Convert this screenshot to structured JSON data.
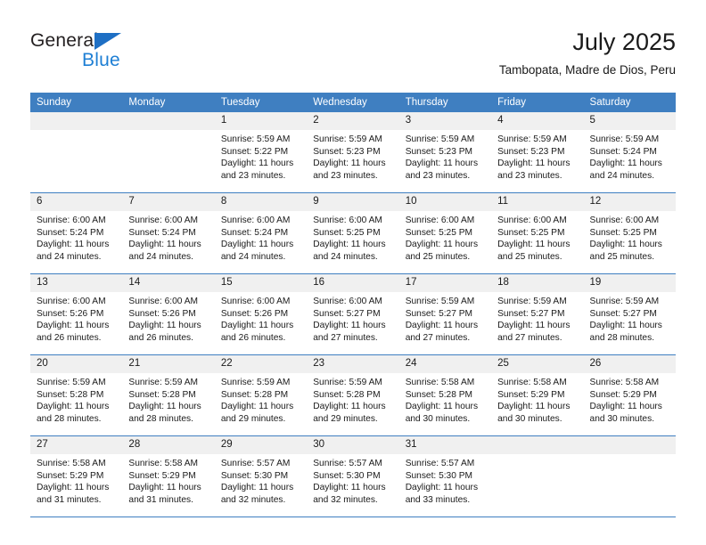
{
  "brand": {
    "general": "General",
    "blue": "Blue",
    "triangle_color": "#1e6fc4",
    "blue_color": "#1e7fd4"
  },
  "header": {
    "title": "July 2025",
    "subtitle": "Tambopata, Madre de Dios, Peru"
  },
  "theme": {
    "header_bg": "#3f7fc1",
    "header_text": "#ffffff",
    "daynum_bg": "#f0f0f0",
    "cell_bg": "#ffffff",
    "row_divider": "#3f7fc1",
    "text": "#1a1a1a"
  },
  "weekdays": [
    "Sunday",
    "Monday",
    "Tuesday",
    "Wednesday",
    "Thursday",
    "Friday",
    "Saturday"
  ],
  "weeks": [
    [
      {
        "day": "",
        "empty": true
      },
      {
        "day": "",
        "empty": true
      },
      {
        "day": "1",
        "sunrise": "Sunrise: 5:59 AM",
        "sunset": "Sunset: 5:22 PM",
        "daylight1": "Daylight: 11 hours",
        "daylight2": "and 23 minutes."
      },
      {
        "day": "2",
        "sunrise": "Sunrise: 5:59 AM",
        "sunset": "Sunset: 5:23 PM",
        "daylight1": "Daylight: 11 hours",
        "daylight2": "and 23 minutes."
      },
      {
        "day": "3",
        "sunrise": "Sunrise: 5:59 AM",
        "sunset": "Sunset: 5:23 PM",
        "daylight1": "Daylight: 11 hours",
        "daylight2": "and 23 minutes."
      },
      {
        "day": "4",
        "sunrise": "Sunrise: 5:59 AM",
        "sunset": "Sunset: 5:23 PM",
        "daylight1": "Daylight: 11 hours",
        "daylight2": "and 23 minutes."
      },
      {
        "day": "5",
        "sunrise": "Sunrise: 5:59 AM",
        "sunset": "Sunset: 5:24 PM",
        "daylight1": "Daylight: 11 hours",
        "daylight2": "and 24 minutes."
      }
    ],
    [
      {
        "day": "6",
        "sunrise": "Sunrise: 6:00 AM",
        "sunset": "Sunset: 5:24 PM",
        "daylight1": "Daylight: 11 hours",
        "daylight2": "and 24 minutes."
      },
      {
        "day": "7",
        "sunrise": "Sunrise: 6:00 AM",
        "sunset": "Sunset: 5:24 PM",
        "daylight1": "Daylight: 11 hours",
        "daylight2": "and 24 minutes."
      },
      {
        "day": "8",
        "sunrise": "Sunrise: 6:00 AM",
        "sunset": "Sunset: 5:24 PM",
        "daylight1": "Daylight: 11 hours",
        "daylight2": "and 24 minutes."
      },
      {
        "day": "9",
        "sunrise": "Sunrise: 6:00 AM",
        "sunset": "Sunset: 5:25 PM",
        "daylight1": "Daylight: 11 hours",
        "daylight2": "and 24 minutes."
      },
      {
        "day": "10",
        "sunrise": "Sunrise: 6:00 AM",
        "sunset": "Sunset: 5:25 PM",
        "daylight1": "Daylight: 11 hours",
        "daylight2": "and 25 minutes."
      },
      {
        "day": "11",
        "sunrise": "Sunrise: 6:00 AM",
        "sunset": "Sunset: 5:25 PM",
        "daylight1": "Daylight: 11 hours",
        "daylight2": "and 25 minutes."
      },
      {
        "day": "12",
        "sunrise": "Sunrise: 6:00 AM",
        "sunset": "Sunset: 5:25 PM",
        "daylight1": "Daylight: 11 hours",
        "daylight2": "and 25 minutes."
      }
    ],
    [
      {
        "day": "13",
        "sunrise": "Sunrise: 6:00 AM",
        "sunset": "Sunset: 5:26 PM",
        "daylight1": "Daylight: 11 hours",
        "daylight2": "and 26 minutes."
      },
      {
        "day": "14",
        "sunrise": "Sunrise: 6:00 AM",
        "sunset": "Sunset: 5:26 PM",
        "daylight1": "Daylight: 11 hours",
        "daylight2": "and 26 minutes."
      },
      {
        "day": "15",
        "sunrise": "Sunrise: 6:00 AM",
        "sunset": "Sunset: 5:26 PM",
        "daylight1": "Daylight: 11 hours",
        "daylight2": "and 26 minutes."
      },
      {
        "day": "16",
        "sunrise": "Sunrise: 6:00 AM",
        "sunset": "Sunset: 5:27 PM",
        "daylight1": "Daylight: 11 hours",
        "daylight2": "and 27 minutes."
      },
      {
        "day": "17",
        "sunrise": "Sunrise: 5:59 AM",
        "sunset": "Sunset: 5:27 PM",
        "daylight1": "Daylight: 11 hours",
        "daylight2": "and 27 minutes."
      },
      {
        "day": "18",
        "sunrise": "Sunrise: 5:59 AM",
        "sunset": "Sunset: 5:27 PM",
        "daylight1": "Daylight: 11 hours",
        "daylight2": "and 27 minutes."
      },
      {
        "day": "19",
        "sunrise": "Sunrise: 5:59 AM",
        "sunset": "Sunset: 5:27 PM",
        "daylight1": "Daylight: 11 hours",
        "daylight2": "and 28 minutes."
      }
    ],
    [
      {
        "day": "20",
        "sunrise": "Sunrise: 5:59 AM",
        "sunset": "Sunset: 5:28 PM",
        "daylight1": "Daylight: 11 hours",
        "daylight2": "and 28 minutes."
      },
      {
        "day": "21",
        "sunrise": "Sunrise: 5:59 AM",
        "sunset": "Sunset: 5:28 PM",
        "daylight1": "Daylight: 11 hours",
        "daylight2": "and 28 minutes."
      },
      {
        "day": "22",
        "sunrise": "Sunrise: 5:59 AM",
        "sunset": "Sunset: 5:28 PM",
        "daylight1": "Daylight: 11 hours",
        "daylight2": "and 29 minutes."
      },
      {
        "day": "23",
        "sunrise": "Sunrise: 5:59 AM",
        "sunset": "Sunset: 5:28 PM",
        "daylight1": "Daylight: 11 hours",
        "daylight2": "and 29 minutes."
      },
      {
        "day": "24",
        "sunrise": "Sunrise: 5:58 AM",
        "sunset": "Sunset: 5:28 PM",
        "daylight1": "Daylight: 11 hours",
        "daylight2": "and 30 minutes."
      },
      {
        "day": "25",
        "sunrise": "Sunrise: 5:58 AM",
        "sunset": "Sunset: 5:29 PM",
        "daylight1": "Daylight: 11 hours",
        "daylight2": "and 30 minutes."
      },
      {
        "day": "26",
        "sunrise": "Sunrise: 5:58 AM",
        "sunset": "Sunset: 5:29 PM",
        "daylight1": "Daylight: 11 hours",
        "daylight2": "and 30 minutes."
      }
    ],
    [
      {
        "day": "27",
        "sunrise": "Sunrise: 5:58 AM",
        "sunset": "Sunset: 5:29 PM",
        "daylight1": "Daylight: 11 hours",
        "daylight2": "and 31 minutes."
      },
      {
        "day": "28",
        "sunrise": "Sunrise: 5:58 AM",
        "sunset": "Sunset: 5:29 PM",
        "daylight1": "Daylight: 11 hours",
        "daylight2": "and 31 minutes."
      },
      {
        "day": "29",
        "sunrise": "Sunrise: 5:57 AM",
        "sunset": "Sunset: 5:30 PM",
        "daylight1": "Daylight: 11 hours",
        "daylight2": "and 32 minutes."
      },
      {
        "day": "30",
        "sunrise": "Sunrise: 5:57 AM",
        "sunset": "Sunset: 5:30 PM",
        "daylight1": "Daylight: 11 hours",
        "daylight2": "and 32 minutes."
      },
      {
        "day": "31",
        "sunrise": "Sunrise: 5:57 AM",
        "sunset": "Sunset: 5:30 PM",
        "daylight1": "Daylight: 11 hours",
        "daylight2": "and 33 minutes."
      },
      {
        "day": "",
        "empty": true
      },
      {
        "day": "",
        "empty": true
      }
    ]
  ]
}
